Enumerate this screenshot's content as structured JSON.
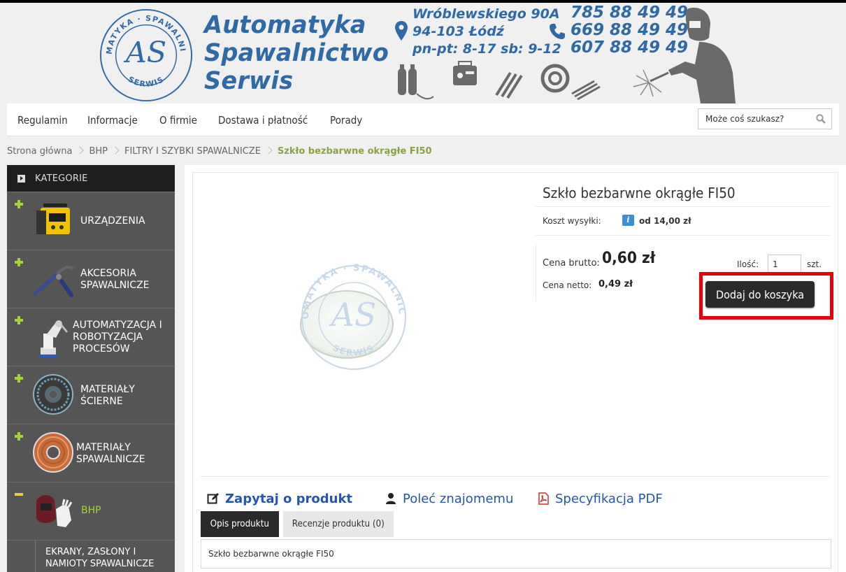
{
  "header": {
    "seal_top": "AUTOMATYKA · SPAWALNICTWO",
    "seal_bottom": "SERWIS",
    "seal_mono": "AS",
    "brand_lines": [
      "Automatyka",
      "Spawalnictwo",
      "Serwis"
    ],
    "address": [
      "Wróblewskiego 90A",
      "94-103 Łódź",
      "pn-pt: 8-17  sb: 9-12"
    ],
    "phones": [
      "785 88 49 49",
      "669 88 49 49",
      "607 88 49 49"
    ]
  },
  "nav": {
    "items": [
      "Regulamin",
      "Informacje",
      "O firmie",
      "Dostawa i płatność",
      "Porady"
    ],
    "search_placeholder": "Może coś szukasz?"
  },
  "breadcrumb": [
    "Strona główna",
    "BHP",
    "FILTRY I SZYBKI SPAWALNICZE",
    "Szkło bezbarwne okrągłe FI50"
  ],
  "sidebar": {
    "heading": "KATEGORIE",
    "categories": [
      {
        "label": [
          "URZĄDZENIA"
        ],
        "expanded": false
      },
      {
        "label": [
          "AKCESORIA",
          "SPAWALNICZE"
        ],
        "expanded": false
      },
      {
        "label": [
          "AUTOMATYZACJA I",
          "ROBOTYZACJA",
          "PROCESÓW"
        ],
        "expanded": false
      },
      {
        "label": [
          "MATERIAŁY",
          "ŚCIERNE"
        ],
        "expanded": false
      },
      {
        "label": [
          "MATERIAŁY",
          "SPAWALNICZE"
        ],
        "expanded": false
      },
      {
        "label": [
          "BHP"
        ],
        "expanded": true
      }
    ],
    "subcategory": [
      "EKRANY, ZASŁONY I",
      "NAMIOTY SPAWALNICZE"
    ]
  },
  "product": {
    "title": "Szkło bezbarwne okrągłe FI50",
    "shipping_label": "Koszt wysyłki:",
    "shipping_value": "od 14,00 zł",
    "gross_label": "Cena brutto:",
    "gross_value": "0,60 zł",
    "net_label": "Cena netto:",
    "net_value": "0,49 zł",
    "qty_label": "Ilość:",
    "qty_value": "1",
    "qty_unit": "szt.",
    "cart_button": "Dodaj do koszyka",
    "watermark_top": "AUTOMATYKA · SPAWALNICTWO",
    "watermark_bottom": "SERWIS"
  },
  "actions": {
    "ask": "Zapytaj o produkt",
    "recommend": "Poleć znajomemu",
    "pdf": "Specyfikacja PDF"
  },
  "tabs": [
    "Opis produktu",
    "Recenzje produktu (0)"
  ],
  "description": "Szkło bezbarwne okrągłe FI50",
  "colors": {
    "brand_blue": "#2f6aa6",
    "link_blue": "#2754b3",
    "accent_green": "#a6d23a",
    "highlight_red": "#e8000c",
    "sidebar_bg": "#555555"
  }
}
